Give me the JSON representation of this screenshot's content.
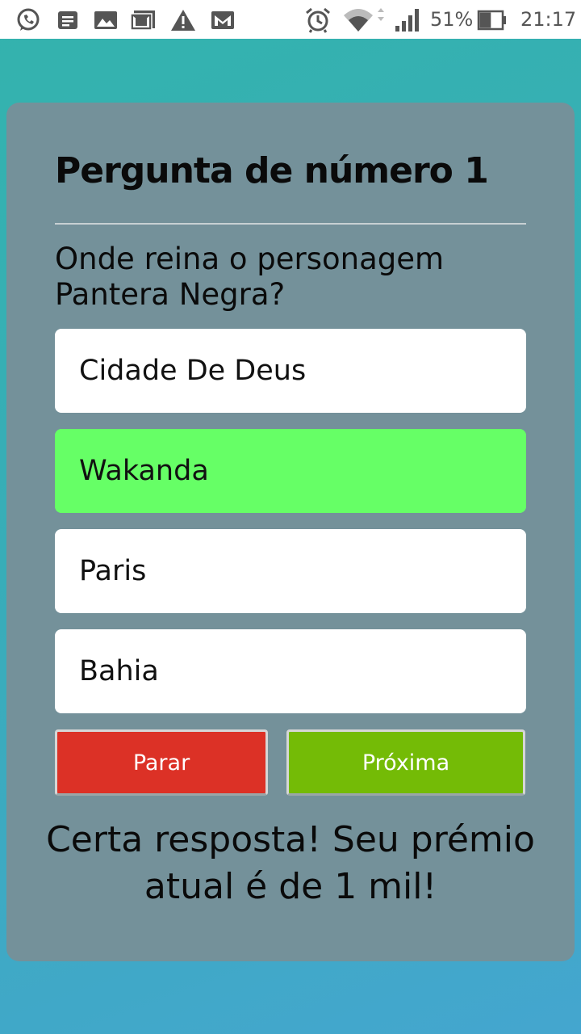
{
  "status_bar": {
    "battery_percent": "51%",
    "battery_level": 0.51,
    "time": "21:17",
    "left_icons": [
      "whatsapp-icon",
      "message-icon",
      "gallery-icon",
      "gmail-icon",
      "warning-icon",
      "gmail-icon"
    ],
    "right_icons": [
      "alarm-icon",
      "wifi-icon",
      "signal-icon",
      "battery-icon"
    ],
    "icon_color": "#555555"
  },
  "quiz": {
    "title": "Pergunta de número 1",
    "question": "Onde reina o personagem Pantera Negra?",
    "options": [
      {
        "label": "Cidade De Deus",
        "state": "normal"
      },
      {
        "label": "Wakanda",
        "state": "correct"
      },
      {
        "label": "Paris",
        "state": "normal"
      },
      {
        "label": "Bahia",
        "state": "normal"
      }
    ],
    "stop_label": "Parar",
    "next_label": "Próxima",
    "result_message": "Certa resposta! Seu prémio atual é de 1 mil!"
  },
  "colors": {
    "card_background": "#74919a",
    "correct_option": "#66ff66",
    "stop_button": "#dc3126",
    "next_button": "#74bb06",
    "page_gradient_start": "#33b3ad",
    "page_gradient_end": "#44a6cf"
  }
}
